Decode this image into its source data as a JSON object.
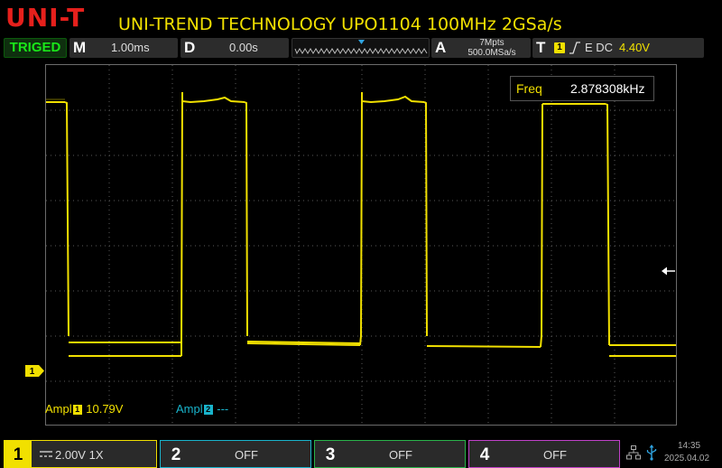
{
  "header": {
    "logo": "UNI-T",
    "model": "UNI-TREND TECHNOLOGY UPO1104 100MHz 2GSa/s"
  },
  "status": {
    "trigger_state": "TRIGED",
    "horizontal_letter": "M",
    "timebase": "1.00ms",
    "delay_letter": "D",
    "delay": "0.00s",
    "acq_letter": "A",
    "memory_depth": "7Mpts",
    "sample_rate": "500.0MSa/s",
    "trigger_letter": "T",
    "trigger_source": "1",
    "trigger_coupling": "E DC",
    "trigger_level": "4.40V"
  },
  "markers": {
    "trigger_position": "T",
    "ch1": "1"
  },
  "measurements": {
    "freq_label": "Freq",
    "freq_value": "2.878308kHz",
    "ampl1_label": "Ampl",
    "ampl1_channel": "1",
    "ampl1_value": "10.79V",
    "ampl2_label": "Ampl",
    "ampl2_channel": "2",
    "ampl2_value": "---"
  },
  "channels": [
    {
      "number": "1",
      "setting": "2.00V 1X",
      "color": "#f1e000"
    },
    {
      "number": "2",
      "setting": "OFF",
      "color": "#19b4cc"
    },
    {
      "number": "3",
      "setting": "OFF",
      "color": "#29b44a"
    },
    {
      "number": "4",
      "setting": "OFF",
      "color": "#c040c8"
    }
  ],
  "clock": {
    "time": "14:35",
    "date": "2025.04.02"
  },
  "colors": {
    "ch1": "#f1e000",
    "ch2": "#19b4cc",
    "triged": "#19e619",
    "logo": "#e6201c"
  },
  "icons": [
    "dc-coupling-icon",
    "rising-edge-icon",
    "network-icon",
    "usb-icon",
    "trigger-level-arrow-icon"
  ]
}
